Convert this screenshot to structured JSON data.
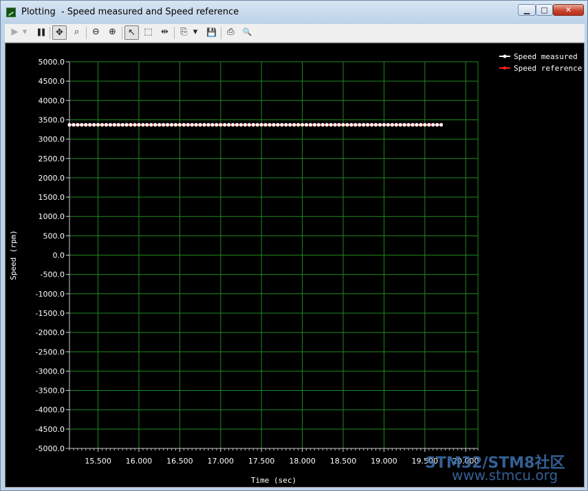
{
  "window": {
    "title": "Plotting  - Speed measured and Speed reference",
    "minimize_glyph": "▁",
    "maximize_glyph": "□",
    "close_glyph": "✕"
  },
  "toolbar": {
    "buttons": [
      {
        "name": "play-icon",
        "glyph": "▶"
      },
      {
        "name": "dropdown-icon",
        "glyph": "▾"
      },
      {
        "name": "pause-icon",
        "glyph": "❚❚"
      },
      {
        "name": "pan-icon",
        "glyph": "✥"
      },
      {
        "name": "zoom-area-icon",
        "glyph": "⌕"
      },
      {
        "name": "zoom-out-icon",
        "glyph": "⊖"
      },
      {
        "name": "zoom-in-icon",
        "glyph": "⊕"
      },
      {
        "name": "select-pointer-icon",
        "glyph": "↖"
      },
      {
        "name": "select-rect-icon",
        "glyph": "⬚"
      },
      {
        "name": "fit-width-icon",
        "glyph": "⇹"
      },
      {
        "name": "copy-icon",
        "glyph": "⎘"
      },
      {
        "name": "copy-dropdown-icon",
        "glyph": "▾"
      },
      {
        "name": "save-icon",
        "glyph": "💾"
      },
      {
        "name": "print-icon",
        "glyph": "⎙"
      },
      {
        "name": "print-preview-icon",
        "glyph": "🔍"
      }
    ]
  },
  "watermark": {
    "line1": "STM32/STM8社区",
    "line2": "www.stmcu.org",
    "color": "#3e71b0"
  },
  "chart_data": {
    "type": "line",
    "title": "",
    "xlabel": "Time (sec)",
    "ylabel": "Speed (rpm)",
    "xlim": [
      15.15,
      20.15
    ],
    "ylim": [
      -5000,
      5000
    ],
    "x_ticks": [
      15.5,
      16.0,
      16.5,
      17.0,
      17.5,
      18.0,
      18.5,
      19.0,
      19.5,
      20.0
    ],
    "x_tick_labels": [
      "15.500",
      "16.000",
      "16.500",
      "17.000",
      "17.500",
      "18.000",
      "18.500",
      "19.000",
      "19.500",
      "20.000"
    ],
    "y_ticks": [
      5000,
      4500,
      4000,
      3500,
      3000,
      2500,
      2000,
      1500,
      1000,
      500,
      0,
      -500,
      -1000,
      -1500,
      -2000,
      -2500,
      -3000,
      -3500,
      -4000,
      -4500,
      -5000
    ],
    "y_tick_labels": [
      "5000.0",
      "4500.0",
      "4000.0",
      "3500.0",
      "3000.0",
      "2500.0",
      "2000.0",
      "1500.0",
      "1000.0",
      "500.0",
      "0.0",
      "-500.0",
      "-1000.0",
      "-1500.0",
      "-2000.0",
      "-2500.0",
      "-3000.0",
      "-3500.0",
      "-4000.0",
      "-4500.0",
      "-5000.0"
    ],
    "grid": true,
    "grid_color": "#1f8a1f",
    "background": "#000000",
    "legend_position": "top-right",
    "x": [
      15.15,
      15.2,
      15.25,
      15.3,
      15.35,
      15.4,
      15.45,
      15.5,
      15.55,
      15.6,
      15.65,
      15.7,
      15.75,
      15.8,
      15.85,
      15.9,
      15.95,
      16.0,
      16.05,
      16.1,
      16.15,
      16.2,
      16.25,
      16.3,
      16.35,
      16.4,
      16.45,
      16.5,
      16.55,
      16.6,
      16.65,
      16.7,
      16.75,
      16.8,
      16.85,
      16.9,
      16.95,
      17.0,
      17.05,
      17.1,
      17.15,
      17.2,
      17.25,
      17.3,
      17.35,
      17.4,
      17.45,
      17.5,
      17.55,
      17.6,
      17.65,
      17.7,
      17.75,
      17.8,
      17.85,
      17.9,
      17.95,
      18.0,
      18.05,
      18.1,
      18.15,
      18.2,
      18.25,
      18.3,
      18.35,
      18.4,
      18.45,
      18.5,
      18.55,
      18.6,
      18.65,
      18.7,
      18.75,
      18.8,
      18.85,
      18.9,
      18.95,
      19.0,
      19.05,
      19.1,
      19.15,
      19.2,
      19.25,
      19.3,
      19.35,
      19.4,
      19.45,
      19.5,
      19.55,
      19.6,
      19.65,
      19.7
    ],
    "series": [
      {
        "name": "Speed measured",
        "color": "#ffffff",
        "marker": "circle",
        "value": 3370
      },
      {
        "name": "Speed reference",
        "color": "#ff2020",
        "marker": "square",
        "value": 3370
      }
    ]
  }
}
